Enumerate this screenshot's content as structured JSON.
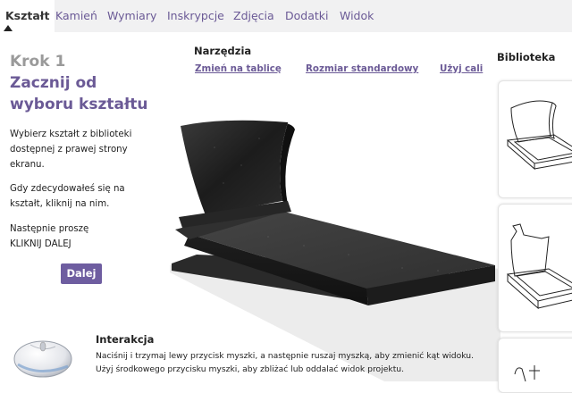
{
  "tabs": [
    {
      "label": "Kształt",
      "active": true
    },
    {
      "label": "Kamień"
    },
    {
      "label": "Wymiary"
    },
    {
      "label": "Inskrypcje"
    },
    {
      "label": "Zdjęcia"
    },
    {
      "label": "Dodatki"
    },
    {
      "label": "Widok"
    }
  ],
  "step": {
    "label": "Krok 1",
    "title_line1": "Zacznij od",
    "title_line2": "wyboru kształtu",
    "instr1": [
      "Wybierz kształt z biblioteki",
      "dostępnej z prawej strony",
      "ekranu."
    ],
    "instr2": [
      "Gdy zdecydowałeś się na",
      "kształt, kliknij na nim."
    ],
    "instr3": [
      "Następnie proszę",
      "KLIKNIJ DALEJ"
    ],
    "next_label": "Dalej"
  },
  "tools": {
    "title": "Narzędzia",
    "links": [
      "Zmień na tablicę",
      "Rozmiar standardowy",
      "Użyj cali"
    ]
  },
  "library": {
    "title": "Biblioteka"
  },
  "interaction": {
    "title": "Interakcja",
    "line1": "Naciśnij i trzymaj lewy przycisk myszki, a następnie ruszaj myszką, aby zmienić kąt widoku.",
    "line2": "Użyj środkowego przycisku myszki, aby zbliżać lub oddalać widok projektu."
  },
  "colors": {
    "accent": "#6e5da0",
    "tab_text": "#6b5a96",
    "granite": "#262626"
  },
  "icons": [
    "mouse-icon",
    "tab-pointer-icon"
  ]
}
